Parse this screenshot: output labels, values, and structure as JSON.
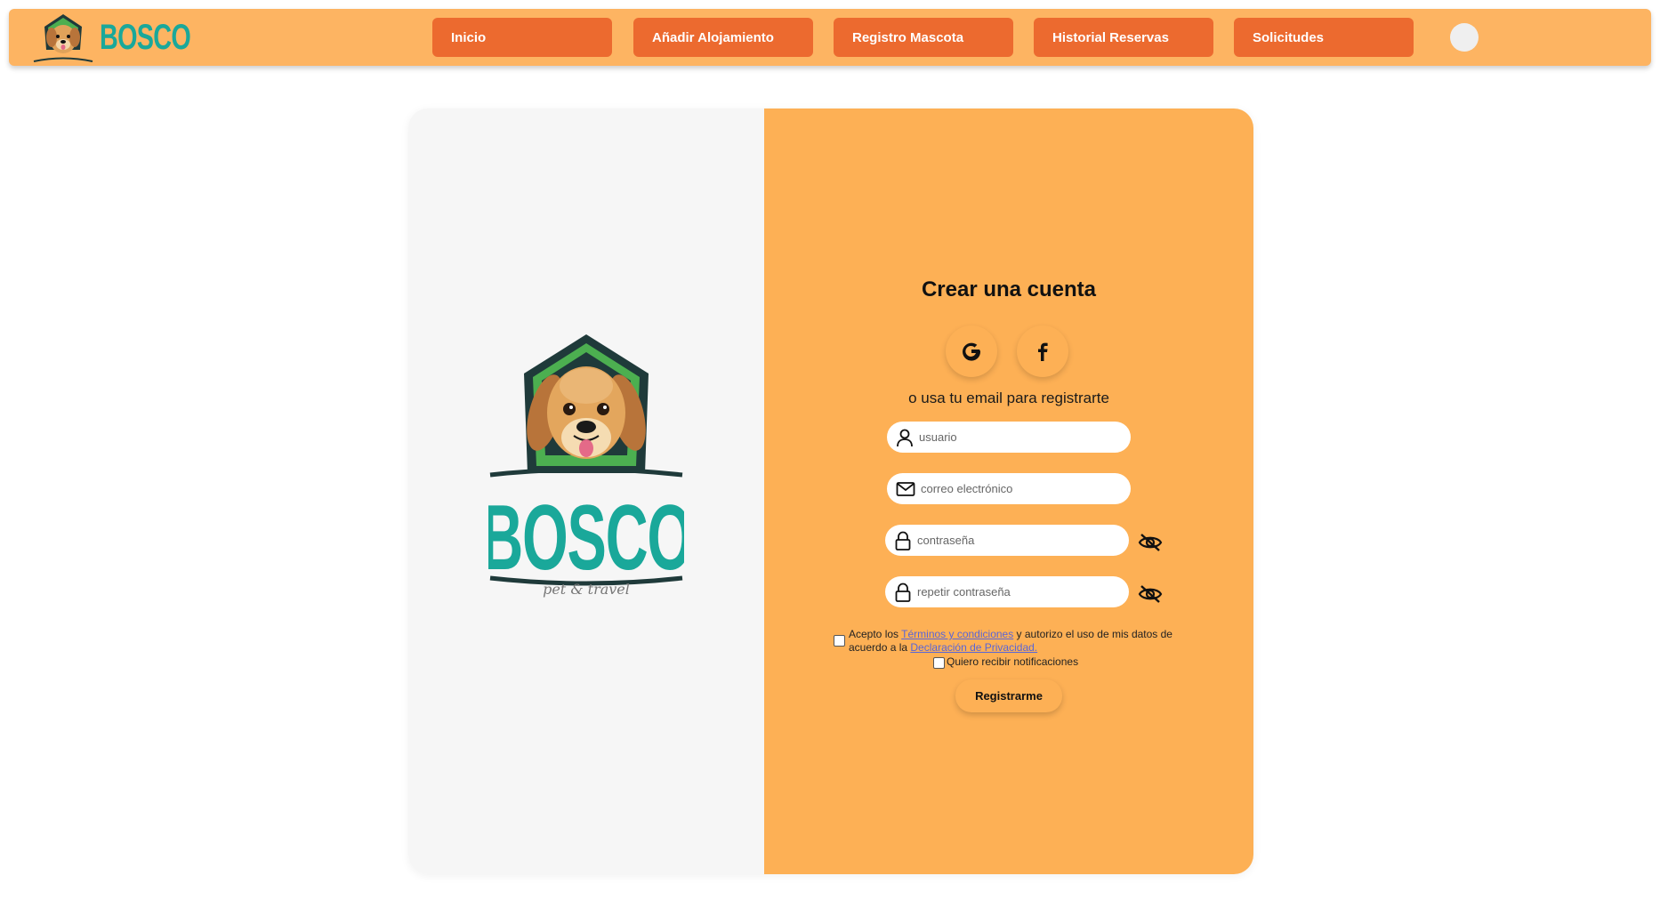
{
  "header": {
    "brand": "BOSCO",
    "nav": [
      {
        "label": "Inicio"
      },
      {
        "label": "Añadir Alojamiento"
      },
      {
        "label": "Registro Mascota"
      },
      {
        "label": "Historial Reservas"
      },
      {
        "label": "Solicitudes"
      }
    ]
  },
  "hero_logo": {
    "brand": "BOSCO",
    "tagline": "pet & travel"
  },
  "form": {
    "title": "Crear una cuenta",
    "social": [
      {
        "icon": "google-icon"
      },
      {
        "icon": "facebook-icon"
      }
    ],
    "alt_text": "o usa tu email para registrarte",
    "fields": {
      "username_placeholder": "usuario",
      "email_placeholder": "correo electrónico",
      "password_placeholder": "contraseña",
      "repeat_password_placeholder": "repetir contraseña"
    },
    "terms": {
      "prefix": "Acepto los ",
      "terms_link": "Términos y condiciones",
      "middle": " y autorizo el uso de mis datos de acuerdo a la ",
      "privacy_link": "Declaración de Privacidad."
    },
    "notifications_label": "Quiero recibir notificaciones",
    "submit_label": "Registrarme"
  },
  "colors": {
    "header_bg": "#fdb462",
    "nav_button": "#ec6a2f",
    "form_panel": "#fdb055",
    "logo_panel": "#f6f6f6",
    "brand_teal": "#1aa89a",
    "link": "#5865d8"
  }
}
